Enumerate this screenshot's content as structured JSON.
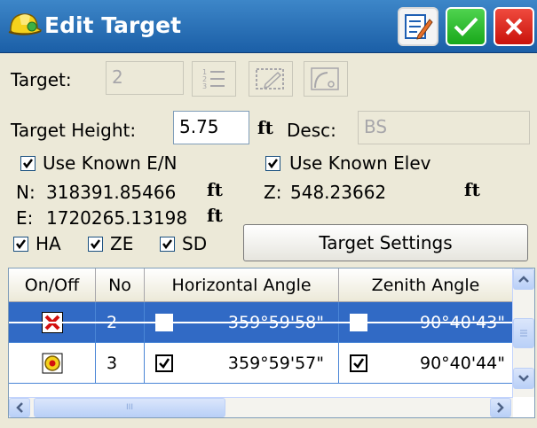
{
  "window": {
    "title": "Edit Target",
    "icons": [
      "hard-hat-icon",
      "edit-icon",
      "checkmark-icon",
      "close-icon"
    ],
    "colors": {
      "titlebar": "#1b5fa7",
      "ok_button": "#19a81b",
      "close_button": "#c9130b",
      "selection": "#316ac5"
    }
  },
  "target": {
    "label": "Target:",
    "value": "2"
  },
  "target_height": {
    "label": "Target Height:",
    "value": "5.75",
    "unit": "ft"
  },
  "desc": {
    "label": "Desc:",
    "value": "BS"
  },
  "known_en": {
    "label": "Use Known E/N",
    "checked": true
  },
  "known_elev": {
    "label": "Use Known Elev",
    "checked": true
  },
  "coords": {
    "n_label": "N:",
    "n_value": "318391.85466",
    "n_unit": "ft",
    "z_label": "Z:",
    "z_value": "548.23662",
    "z_unit": "ft",
    "e_label": "E:",
    "e_value": "1720265.13198",
    "e_unit": "ft"
  },
  "filters": {
    "ha_label": "HA",
    "ha_checked": true,
    "ze_label": "ZE",
    "ze_checked": true,
    "sd_label": "SD",
    "sd_checked": true
  },
  "target_settings_label": "Target Settings",
  "table": {
    "columns": [
      "On/Off",
      "No",
      "Horizontal Angle",
      "Zenith Angle"
    ],
    "rows": [
      {
        "on": false,
        "no": "2",
        "ha_checked": false,
        "ha": "359°59'58\"",
        "ze_checked": false,
        "ze": "90°40'43\"",
        "selected": true
      },
      {
        "on": true,
        "no": "3",
        "ha_checked": true,
        "ha": "359°59'57\"",
        "ze_checked": true,
        "ze": "90°40'44\"",
        "selected": false
      }
    ]
  },
  "scrollbar": {
    "horizontal_grip": "III"
  }
}
